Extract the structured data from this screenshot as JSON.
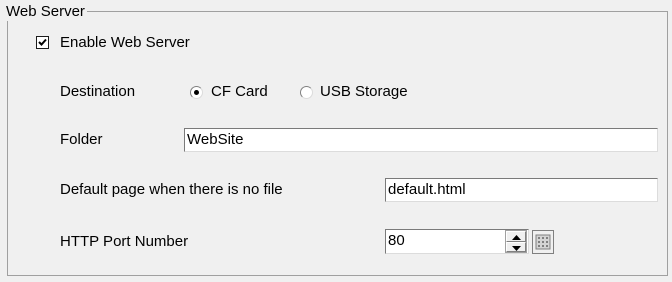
{
  "group": {
    "title": "Web Server"
  },
  "enable_web_server": {
    "label": "Enable Web Server",
    "checked": true
  },
  "destination": {
    "label": "Destination",
    "options": [
      {
        "label": "CF Card",
        "selected": true
      },
      {
        "label": "USB Storage",
        "selected": false
      }
    ]
  },
  "folder": {
    "label": "Folder",
    "value": "WebSite"
  },
  "default_page": {
    "label": "Default page when there is no file",
    "value": "default.html"
  },
  "http_port": {
    "label": "HTTP Port Number",
    "value": "80"
  },
  "icons": {
    "spin_up": "triangle-up-icon",
    "spin_down": "triangle-down-icon",
    "keypad": "keypad-icon",
    "check": "checkmark-icon"
  }
}
